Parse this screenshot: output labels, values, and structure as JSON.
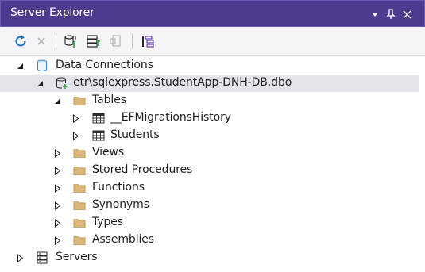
{
  "window": {
    "title": "Server Explorer"
  },
  "tree": {
    "data_connections": "Data Connections",
    "connection": "etr\\sqlexpress.StudentApp-DNH-DB.dbo",
    "tables": "Tables",
    "ef_history": "__EFMigrationsHistory",
    "students": "Students",
    "views": "Views",
    "stored_procedures": "Stored Procedures",
    "functions": "Functions",
    "synonyms": "Synonyms",
    "types": "Types",
    "assemblies": "Assemblies",
    "servers": "Servers"
  },
  "colors": {
    "title_bar": "#4e3b8f",
    "toolbar_bg": "#f5f5f7",
    "selection": "#e4e4ea",
    "folder": "#dcb67a",
    "accent_blue": "#1e6fc4"
  },
  "icons": {
    "title_buttons": [
      "dropdown-icon",
      "pin-icon",
      "close-icon"
    ],
    "toolbar": [
      "refresh-icon",
      "stop-icon",
      "connect-database-icon",
      "connect-server-icon",
      "sharepoint-icon",
      "hierarchy-icon"
    ],
    "tree": [
      "database-icon",
      "connection-icon",
      "folder-icon",
      "table-icon",
      "server-icon"
    ]
  }
}
